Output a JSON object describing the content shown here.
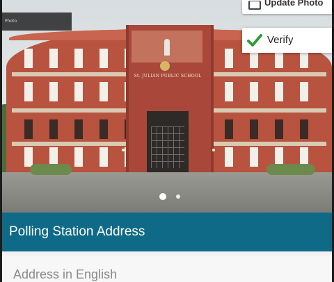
{
  "carousel": {
    "school_sign": "St. JULIAN PUBLIC SCHOOL",
    "photo_badge_text": "Photo",
    "slide_index": 1,
    "slide_count": 2
  },
  "actions": {
    "update_photo_label": "Update Photo",
    "verify_label": "Verify",
    "verify_icon": "check-icon",
    "camera_icon": "camera-icon"
  },
  "section": {
    "title": "Polling Station Address"
  },
  "address": {
    "label": "Address in English"
  },
  "colors": {
    "header_bg": "#0f6a87",
    "check_green": "#2e9b35"
  }
}
